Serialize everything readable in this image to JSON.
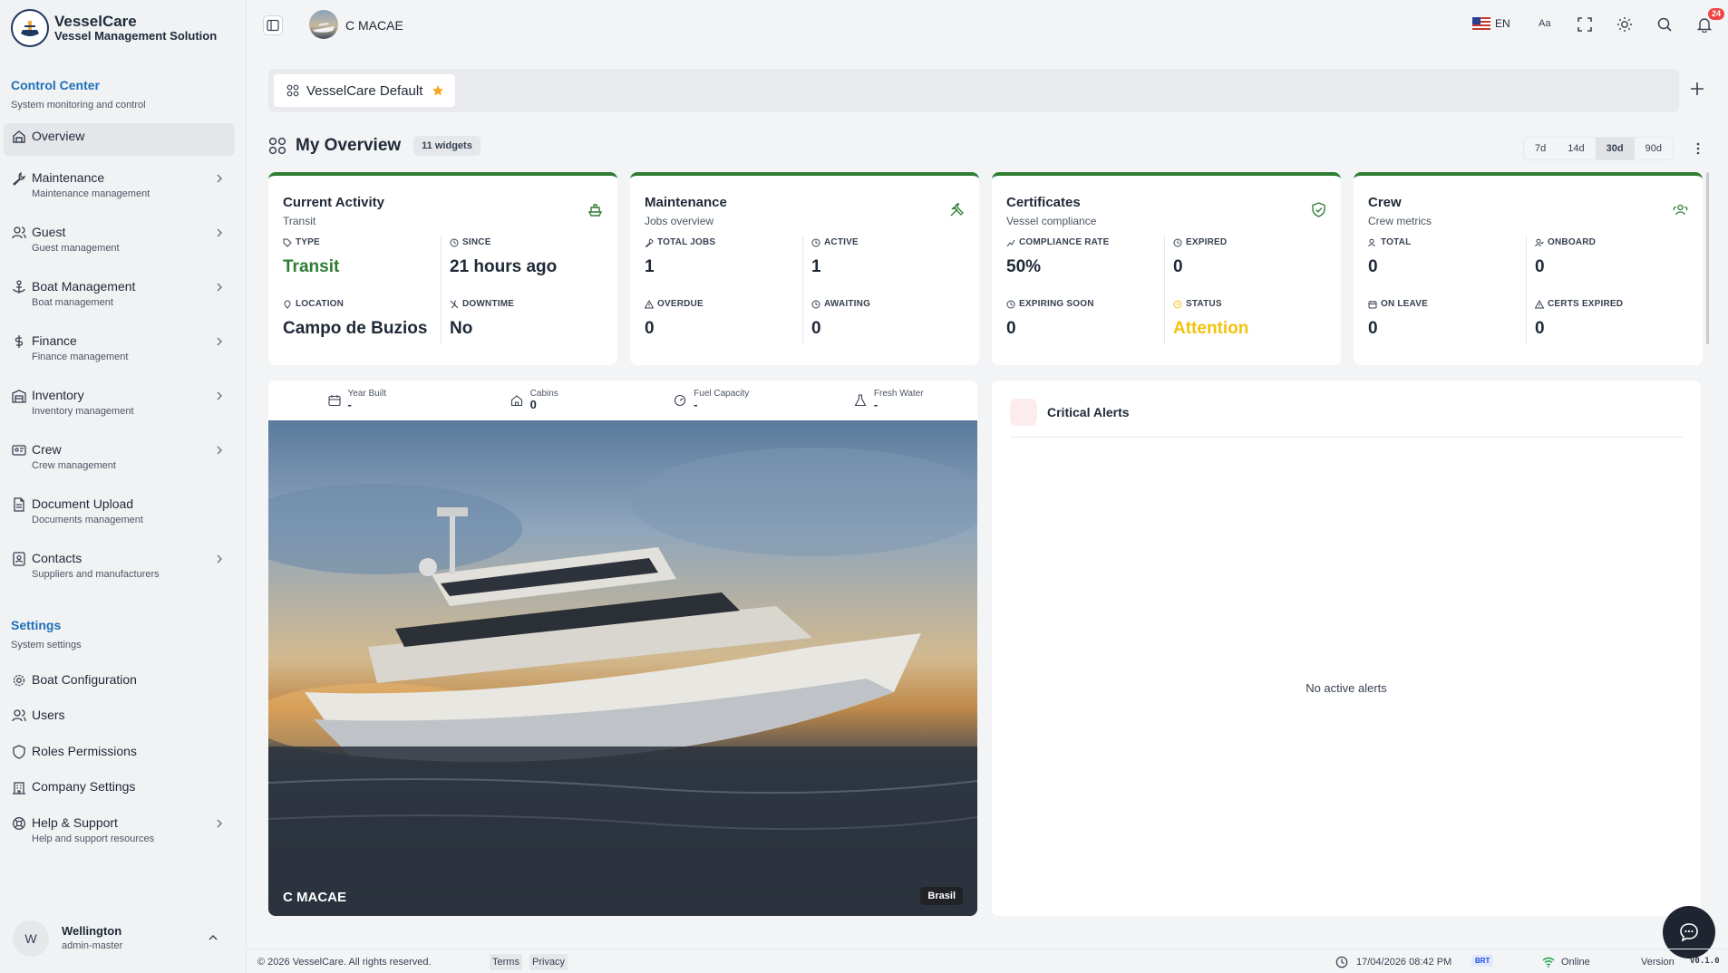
{
  "brand": {
    "name": "VesselCare",
    "subtitle": "Vessel Management Solution"
  },
  "sidebar": {
    "control_center": {
      "title": "Control Center",
      "subtitle": "System monitoring and control"
    },
    "items": [
      {
        "label": "Overview",
        "desc": ""
      },
      {
        "label": "Maintenance",
        "desc": "Maintenance management"
      },
      {
        "label": "Guest",
        "desc": "Guest management"
      },
      {
        "label": "Boat Management",
        "desc": "Boat management"
      },
      {
        "label": "Finance",
        "desc": "Finance management"
      },
      {
        "label": "Inventory",
        "desc": "Inventory management"
      },
      {
        "label": "Crew",
        "desc": "Crew management"
      },
      {
        "label": "Document Upload",
        "desc": "Documents management"
      },
      {
        "label": "Contacts",
        "desc": "Suppliers and manufacturers"
      }
    ],
    "settings": {
      "title": "Settings",
      "subtitle": "System settings"
    },
    "settings_items": [
      {
        "label": "Boat Configuration",
        "desc": ""
      },
      {
        "label": "Users",
        "desc": ""
      },
      {
        "label": "Roles Permissions",
        "desc": ""
      },
      {
        "label": "Company Settings",
        "desc": ""
      },
      {
        "label": "Help & Support",
        "desc": "Help and support resources"
      }
    ],
    "user": {
      "initial": "W",
      "name": "Wellington",
      "role": "admin-master"
    }
  },
  "topbar": {
    "vessel": "C MACAE",
    "lang": "EN",
    "font_btn": "Aa",
    "notifications": "24"
  },
  "tabs": [
    {
      "label": "VesselCare Default",
      "starred": true
    }
  ],
  "overview": {
    "title": "My Overview",
    "widget_count": "11 widgets",
    "ranges": [
      "7d",
      "14d",
      "30d",
      "90d"
    ],
    "active_range": "30d"
  },
  "cards": [
    {
      "title": "Current Activity",
      "subtitle": "Transit",
      "metrics": [
        {
          "label": "TYPE",
          "value": "Transit"
        },
        {
          "label": "SINCE",
          "value": "21 hours ago"
        },
        {
          "label": "LOCATION",
          "value": "Campo de Buzios"
        },
        {
          "label": "DOWNTIME",
          "value": "No"
        }
      ]
    },
    {
      "title": "Maintenance",
      "subtitle": "Jobs overview",
      "metrics": [
        {
          "label": "TOTAL JOBS",
          "value": "1"
        },
        {
          "label": "ACTIVE",
          "value": "1"
        },
        {
          "label": "OVERDUE",
          "value": "0"
        },
        {
          "label": "AWAITING",
          "value": "0"
        }
      ]
    },
    {
      "title": "Certificates",
      "subtitle": "Vessel compliance",
      "metrics": [
        {
          "label": "COMPLIANCE RATE",
          "value": "50%"
        },
        {
          "label": "EXPIRED",
          "value": "0"
        },
        {
          "label": "EXPIRING SOON",
          "value": "0"
        },
        {
          "label": "STATUS",
          "value": "Attention"
        }
      ]
    },
    {
      "title": "Crew",
      "subtitle": "Crew metrics",
      "metrics": [
        {
          "label": "TOTAL",
          "value": "0"
        },
        {
          "label": "ONBOARD",
          "value": "0"
        },
        {
          "label": "ON LEAVE",
          "value": "0"
        },
        {
          "label": "CERTS EXPIRED",
          "value": "0"
        }
      ]
    }
  ],
  "vessel_panel": {
    "specs": [
      {
        "label": "Year Built",
        "value": "-"
      },
      {
        "label": "Cabins",
        "value": "0"
      },
      {
        "label": "Fuel Capacity",
        "value": "-"
      },
      {
        "label": "Fresh Water",
        "value": "-"
      }
    ],
    "photo_label": "C MACAE",
    "flag_label": "Brasil"
  },
  "alerts": {
    "title": "Critical Alerts",
    "empty": "No active alerts"
  },
  "footer": {
    "copyright": "© 2026 VesselCare. All rights reserved.",
    "terms": "Terms",
    "privacy": "Privacy",
    "datetime": "17/04/2026 08:42 PM",
    "tz": "BRT",
    "status": "Online",
    "version_label": "Version",
    "version": "v0.1.0"
  },
  "colors": {
    "accent": "#1d6fb8",
    "card_top": "#2e7d32",
    "success": "#2e7d32",
    "warning": "#f4c20d",
    "danger": "#ef4444"
  }
}
